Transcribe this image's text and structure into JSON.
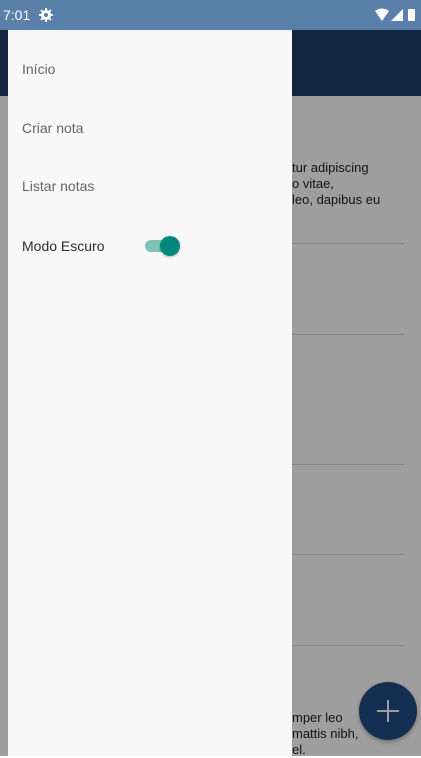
{
  "status_bar": {
    "time": "7:01",
    "icons": [
      "gear-icon",
      "wifi-icon",
      "signal-icon",
      "battery-icon"
    ],
    "color": "#5a7fa8"
  },
  "drawer": {
    "items": [
      {
        "label": "Início"
      },
      {
        "label": "Criar nota"
      },
      {
        "label": "Listar notas"
      }
    ],
    "dark_mode": {
      "label": "Modo Escuro",
      "enabled": true,
      "accent_color": "#00897b"
    }
  },
  "notes_preview": [
    {
      "lines": [
        "tur adipiscing",
        "o vitae,",
        "leo, dapibus eu"
      ]
    },
    {
      "lines": [
        "mper leo",
        "mattis nibh,",
        "el."
      ]
    }
  ],
  "fab": {
    "icon": "plus-icon",
    "color": "#1f4b82"
  },
  "toolbar": {
    "color": "#1e3f66"
  }
}
